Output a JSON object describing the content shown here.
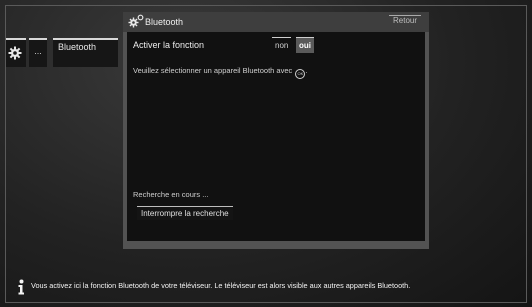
{
  "breadcrumb": {
    "icons": [
      "gear-icon"
    ],
    "ellipsis": "...",
    "current": "Bluetooth"
  },
  "panel": {
    "title": "Bluetooth",
    "title_icon": "bluetooth-settings-icon",
    "back_label": "Retour",
    "activate_label": "Activer la fonction",
    "option_no": "non",
    "option_yes": "oui",
    "selected_option": "oui",
    "hint_text": "Veuillez sélectionner un appareil Bluetooth avec",
    "hint_icon": "ok-button-icon",
    "hint_icon_text": "OK",
    "hint_suffix": ".",
    "status_text": "Recherche en cours ...",
    "stop_label": "Interrompre la recherche"
  },
  "info": {
    "icon": "info-icon",
    "text": "Vous activez ici la fonction Bluetooth de votre téléviseur. Le téléviseur est alors visible aux autres appareils Bluetooth."
  },
  "colors": {
    "background": "#222222",
    "panel": "#535353",
    "panel_body": "#111111",
    "selected": "#5a5a5a"
  }
}
